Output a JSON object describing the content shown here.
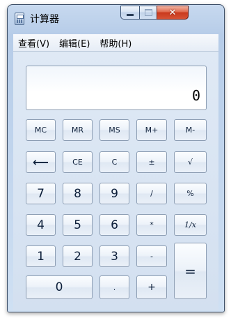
{
  "window": {
    "title": "计算器"
  },
  "menu": {
    "view": "查看(V)",
    "edit": "编辑(E)",
    "help": "帮助(H)"
  },
  "display": {
    "value": "0"
  },
  "keys": {
    "mc": "MC",
    "mr": "MR",
    "ms": "MS",
    "mplus": "M+",
    "mminus": "M-",
    "backspace": "⟵",
    "ce": "CE",
    "c": "C",
    "plusminus": "±",
    "sqrt": "√",
    "n7": "7",
    "n8": "8",
    "n9": "9",
    "div": "/",
    "percent": "%",
    "n4": "4",
    "n5": "5",
    "n6": "6",
    "mul": "*",
    "recip": "1/x",
    "n1": "1",
    "n2": "2",
    "n3": "3",
    "sub": "-",
    "eq": "=",
    "n0": "0",
    "dot": ".",
    "add": "+"
  },
  "icons": {
    "app": "calculator-icon",
    "minimize": "minimize-icon",
    "maximize": "maximize-icon",
    "close": "close-icon",
    "backspace": "backspace-arrow-icon"
  },
  "colors": {
    "close_button": "#c9391d",
    "window_frame": "#b6cce8"
  }
}
